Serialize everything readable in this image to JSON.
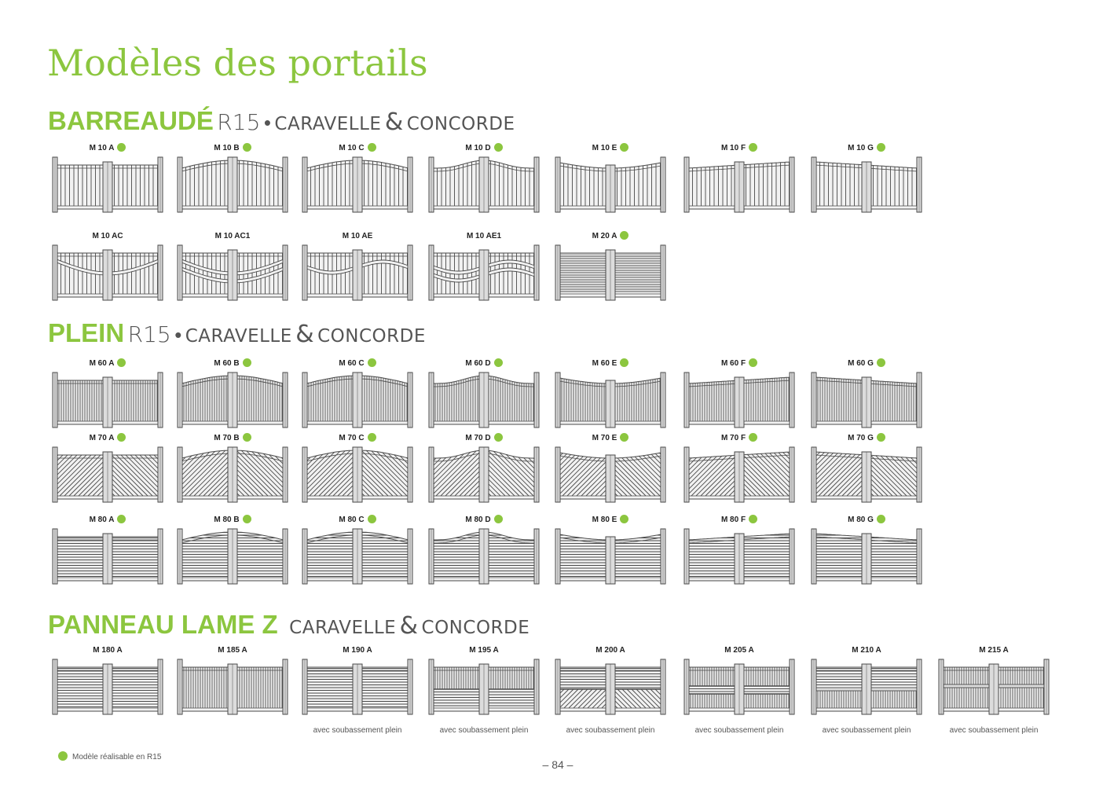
{
  "title": "Modèles des portails",
  "sections": [
    {
      "bold": "BARREAUDÉ",
      "r15": "R15",
      "dot": "•",
      "brand1": "CARAVELLE",
      "amp": "&",
      "brand2": "CONCORDE"
    },
    {
      "bold": "PLEIN",
      "r15": "R15",
      "dot": "•",
      "brand1": "CARAVELLE",
      "amp": "&",
      "brand2": "CONCORDE"
    },
    {
      "bold": "PANNEAU LAME Z",
      "brand1": "CARAVELLE",
      "amp": "&",
      "brand2": "CONCORDE"
    }
  ],
  "gates": [
    {
      "code": "M 10 A",
      "r15": true,
      "fill": "v",
      "top": "flat"
    },
    {
      "code": "M 10 B",
      "r15": true,
      "fill": "v",
      "top": "convex"
    },
    {
      "code": "M 10 C",
      "r15": true,
      "fill": "v",
      "top": "concave"
    },
    {
      "code": "M 10 D",
      "r15": true,
      "fill": "v",
      "top": "chapeau"
    },
    {
      "code": "M 10 E",
      "r15": true,
      "fill": "v",
      "top": "wave"
    },
    {
      "code": "M 10 F",
      "r15": true,
      "fill": "v",
      "top": "peak"
    },
    {
      "code": "M 10 G",
      "r15": true,
      "fill": "v",
      "top": "valley"
    },
    {
      "code": "M 10 AC",
      "r15": false,
      "fill": "v",
      "top": "flat",
      "rail": "concave"
    },
    {
      "code": "M 10 AC1",
      "r15": false,
      "fill": "v",
      "top": "flat",
      "rail": "double"
    },
    {
      "code": "M 10 AE",
      "r15": false,
      "fill": "v",
      "top": "flat",
      "rail": "wave"
    },
    {
      "code": "M 10 AE1",
      "r15": false,
      "fill": "v",
      "top": "flat",
      "rail": "doublewave"
    },
    {
      "code": "M 20 A",
      "r15": true,
      "fill": "hsep",
      "top": "flat"
    },
    {
      "code": "M 60 A",
      "r15": true,
      "fill": "vd",
      "top": "flat"
    },
    {
      "code": "M 60 B",
      "r15": true,
      "fill": "vd",
      "top": "convex"
    },
    {
      "code": "M 60 C",
      "r15": true,
      "fill": "vd",
      "top": "concave"
    },
    {
      "code": "M 60 D",
      "r15": true,
      "fill": "vd",
      "top": "chapeau"
    },
    {
      "code": "M 60 E",
      "r15": true,
      "fill": "vd",
      "top": "wave"
    },
    {
      "code": "M 60 F",
      "r15": true,
      "fill": "vd",
      "top": "peak"
    },
    {
      "code": "M 60 G",
      "r15": true,
      "fill": "vd",
      "top": "valley"
    },
    {
      "code": "M 70 A",
      "r15": true,
      "fill": "diag",
      "top": "flat"
    },
    {
      "code": "M 70 B",
      "r15": true,
      "fill": "diag",
      "top": "convex"
    },
    {
      "code": "M 70 C",
      "r15": true,
      "fill": "diag",
      "top": "concave"
    },
    {
      "code": "M 70 D",
      "r15": true,
      "fill": "diag",
      "top": "chapeau"
    },
    {
      "code": "M 70 E",
      "r15": true,
      "fill": "diag",
      "top": "wave"
    },
    {
      "code": "M 70 F",
      "r15": true,
      "fill": "diag",
      "top": "peak"
    },
    {
      "code": "M 70 G",
      "r15": true,
      "fill": "diag",
      "top": "valley"
    },
    {
      "code": "M 80 A",
      "r15": true,
      "fill": "h",
      "top": "flat"
    },
    {
      "code": "M 80 B",
      "r15": true,
      "fill": "h",
      "top": "convex"
    },
    {
      "code": "M 80 C",
      "r15": true,
      "fill": "h",
      "top": "concave"
    },
    {
      "code": "M 80 D",
      "r15": true,
      "fill": "h",
      "top": "chapeau"
    },
    {
      "code": "M 80 E",
      "r15": true,
      "fill": "h",
      "top": "wave"
    },
    {
      "code": "M 80 F",
      "r15": true,
      "fill": "h",
      "top": "peak"
    },
    {
      "code": "M 80 G",
      "r15": true,
      "fill": "h",
      "top": "valley"
    },
    {
      "code": "M 180 A",
      "r15": false,
      "fill": "h",
      "top": "flat"
    },
    {
      "code": "M 185 A",
      "r15": false,
      "fill": "vd",
      "top": "flat"
    },
    {
      "code": "M 190 A",
      "r15": false,
      "fill": "h",
      "top": "flat",
      "note": "avec soubassement plein"
    },
    {
      "code": "M 195 A",
      "r15": false,
      "fill": "v-hbase",
      "top": "flat",
      "note": "avec soubassement plein"
    },
    {
      "code": "M 200 A",
      "r15": false,
      "fill": "h-diagbase",
      "top": "flat",
      "note": "avec soubassement plein"
    },
    {
      "code": "M 205 A",
      "r15": false,
      "fill": "v-hmid",
      "top": "flat",
      "note": "avec soubassement plein"
    },
    {
      "code": "M 210 A",
      "r15": false,
      "fill": "h-vbase",
      "top": "flat",
      "note": "avec soubassement plein"
    },
    {
      "code": "M 215 A",
      "r15": false,
      "fill": "v-rail",
      "top": "flat",
      "note": "avec soubassement plein"
    }
  ],
  "legend": {
    "text": "Modèle réalisable en R15"
  },
  "page_number": "– 84 –",
  "colors": {
    "accent": "#8cc63f",
    "frame": "#dcdcdc",
    "line": "#4a4a4a"
  }
}
